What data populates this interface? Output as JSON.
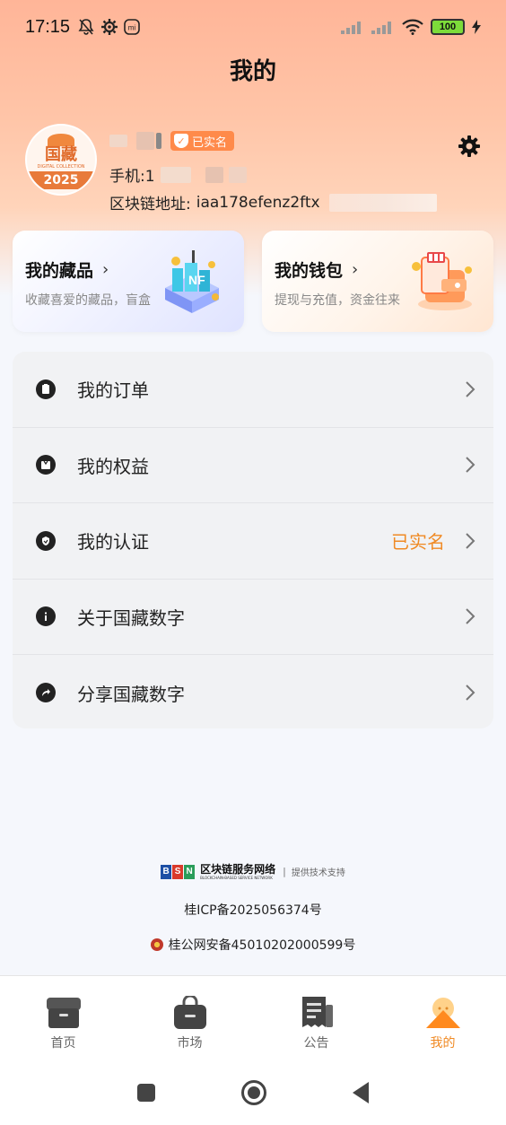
{
  "status_bar": {
    "time": "17:15",
    "battery": "100",
    "icons": [
      "bell-off-icon",
      "gear-icon",
      "mi-icon",
      "signal-icon",
      "signal-icon",
      "wifi-icon",
      "battery-icon",
      "charging-icon"
    ]
  },
  "header": {
    "title": "我的"
  },
  "profile": {
    "verified_badge": "已实名",
    "phone_label": "手机:1",
    "chain_label": "区块链地址:",
    "chain_address": "iaa178efenz2ftx",
    "avatar": {
      "text": "国藏",
      "subtitle": "DIGITAL COLLECTION",
      "year": "2025"
    }
  },
  "cards": [
    {
      "title": "我的藏品",
      "subtitle": "收藏喜爱的藏品，盲盒",
      "icon": "nft-illustration"
    },
    {
      "title": "我的钱包",
      "subtitle": "提现与充值，资金往来",
      "icon": "wallet-illustration"
    }
  ],
  "menu": [
    {
      "label": "我的订单",
      "icon": "order-icon",
      "value": ""
    },
    {
      "label": "我的权益",
      "icon": "benefit-icon",
      "value": ""
    },
    {
      "label": "我的认证",
      "icon": "certification-icon",
      "value": "已实名"
    },
    {
      "label": "关于国藏数字",
      "icon": "info-icon",
      "value": ""
    },
    {
      "label": "分享国藏数字",
      "icon": "share-icon",
      "value": ""
    }
  ],
  "footer": {
    "bsn_letters": [
      "B",
      "S",
      "N"
    ],
    "bsn_name": "区块链服务网络",
    "bsn_en": "BLOCKCHAIN-BASED SERVICE NETWORK",
    "bsn_support": "提供技术支持",
    "icp": "桂ICP备2025056374号",
    "police": "桂公网安备45010202000599号"
  },
  "tabbar": [
    {
      "label": "首页",
      "icon": "home-box-icon",
      "active": false
    },
    {
      "label": "市场",
      "icon": "market-bag-icon",
      "active": false
    },
    {
      "label": "公告",
      "icon": "notice-icon",
      "active": false
    },
    {
      "label": "我的",
      "icon": "profile-mountain-icon",
      "active": true
    }
  ],
  "colors": {
    "accent": "#f08a24",
    "badge": "#ff8a4a",
    "header_gradient_top": "#ffb598"
  }
}
